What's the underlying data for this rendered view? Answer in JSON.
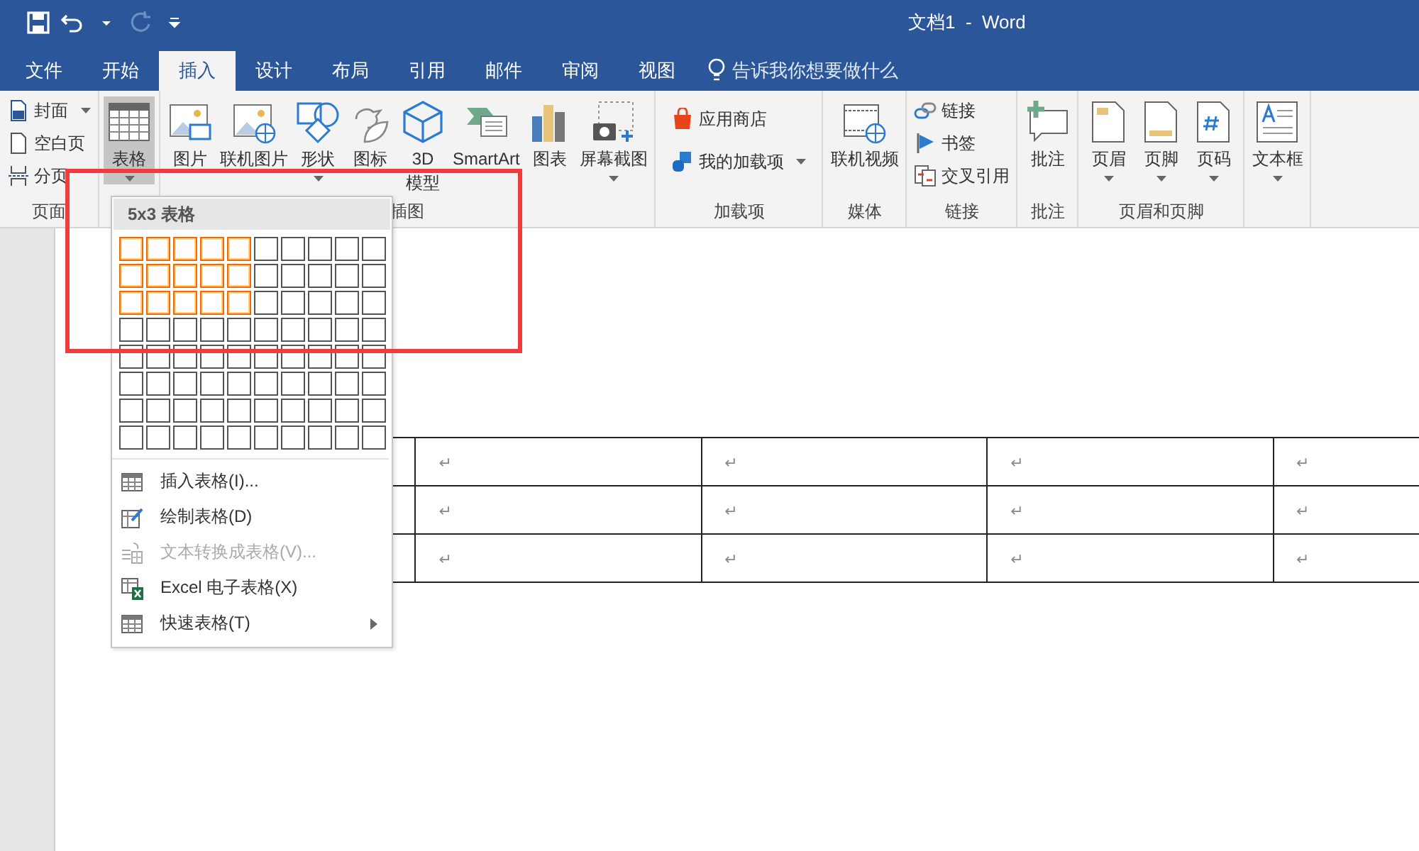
{
  "window": {
    "title": "文档1  -  Word"
  },
  "quick_access": [
    {
      "kind": "save",
      "disabled": false
    },
    {
      "kind": "undo",
      "disabled": false
    },
    {
      "kind": "caret",
      "disabled": false
    },
    {
      "kind": "redo",
      "disabled": true
    },
    {
      "kind": "customize",
      "disabled": false
    }
  ],
  "tabs": [
    {
      "label": "文件",
      "selected": false
    },
    {
      "label": "开始",
      "selected": false
    },
    {
      "label": "插入",
      "selected": true
    },
    {
      "label": "设计",
      "selected": false
    },
    {
      "label": "布局",
      "selected": false
    },
    {
      "label": "引用",
      "selected": false
    },
    {
      "label": "邮件",
      "selected": false
    },
    {
      "label": "审阅",
      "selected": false
    },
    {
      "label": "视图",
      "selected": false
    }
  ],
  "tell_me": {
    "placeholder": "告诉我你想要做什么"
  },
  "ribbon_groups": [
    {
      "label": "页面",
      "items": [
        {
          "kind": "small",
          "label": "封面",
          "dropdown": true,
          "pressed": false
        },
        {
          "kind": "small",
          "label": "空白页",
          "dropdown": false,
          "pressed": false
        },
        {
          "kind": "small",
          "label": "分页",
          "dropdown": false,
          "pressed": false
        }
      ]
    },
    {
      "items": [
        {
          "kind": "large",
          "label": "表格",
          "dropdown": true,
          "pressed": true
        }
      ]
    },
    {
      "label": "插图",
      "items": [
        {
          "kind": "large",
          "label": "图片",
          "dropdown": false,
          "pressed": false
        },
        {
          "kind": "large",
          "label": "联机图片",
          "dropdown": false,
          "pressed": false
        },
        {
          "kind": "large",
          "label": "形状",
          "dropdown": true,
          "pressed": false
        },
        {
          "kind": "large",
          "label": "图标",
          "dropdown": false,
          "pressed": false
        },
        {
          "kind": "large",
          "label": "3D 模型",
          "dropdown": false,
          "pressed": false
        },
        {
          "kind": "large",
          "label": "SmartArt",
          "dropdown": false,
          "pressed": false
        },
        {
          "kind": "large",
          "label": "图表",
          "dropdown": false,
          "pressed": false
        },
        {
          "kind": "large",
          "label": "屏幕截图",
          "dropdown": true,
          "pressed": false
        }
      ]
    },
    {
      "label": "加载项",
      "items": [
        {
          "kind": "medium",
          "label": "应用商店",
          "dropdown": false,
          "pressed": false
        },
        {
          "kind": "medium",
          "label": "我的加载项",
          "dropdown": true,
          "pressed": false
        }
      ]
    },
    {
      "label": "媒体",
      "items": [
        {
          "kind": "large",
          "label": "联机视频",
          "dropdown": false,
          "pressed": false
        }
      ]
    },
    {
      "label": "链接",
      "items": [
        {
          "kind": "small",
          "label": "链接",
          "dropdown": false,
          "pressed": false
        },
        {
          "kind": "small",
          "label": "书签",
          "dropdown": false,
          "pressed": false
        },
        {
          "kind": "small",
          "label": "交叉引用",
          "dropdown": false,
          "pressed": false
        }
      ]
    },
    {
      "label": "批注",
      "items": [
        {
          "kind": "large",
          "label": "批注",
          "dropdown": false,
          "pressed": false
        }
      ]
    },
    {
      "label": "页眉和页脚",
      "items": [
        {
          "kind": "large",
          "label": "页眉",
          "dropdown": true,
          "pressed": false
        },
        {
          "kind": "large",
          "label": "页脚",
          "dropdown": true,
          "pressed": false
        },
        {
          "kind": "large",
          "label": "页码",
          "dropdown": true,
          "pressed": false
        }
      ]
    },
    {
      "items": [
        {
          "kind": "large",
          "label": "文本框",
          "dropdown": true,
          "pressed": false
        }
      ]
    }
  ],
  "table_menu": {
    "header": "5x3 表格",
    "grid_rows": [
      {
        "cells": [
          {
            "selected": true
          },
          {
            "selected": true
          },
          {
            "selected": true
          },
          {
            "selected": true
          },
          {
            "selected": true
          },
          {
            "selected": false
          },
          {
            "selected": false
          },
          {
            "selected": false
          },
          {
            "selected": false
          },
          {
            "selected": false
          }
        ]
      },
      {
        "cells": [
          {
            "selected": true
          },
          {
            "selected": true
          },
          {
            "selected": true
          },
          {
            "selected": true
          },
          {
            "selected": true
          },
          {
            "selected": false
          },
          {
            "selected": false
          },
          {
            "selected": false
          },
          {
            "selected": false
          },
          {
            "selected": false
          }
        ]
      },
      {
        "cells": [
          {
            "selected": true
          },
          {
            "selected": true
          },
          {
            "selected": true
          },
          {
            "selected": true
          },
          {
            "selected": true
          },
          {
            "selected": false
          },
          {
            "selected": false
          },
          {
            "selected": false
          },
          {
            "selected": false
          },
          {
            "selected": false
          }
        ]
      },
      {
        "cells": [
          {
            "selected": false
          },
          {
            "selected": false
          },
          {
            "selected": false
          },
          {
            "selected": false
          },
          {
            "selected": false
          },
          {
            "selected": false
          },
          {
            "selected": false
          },
          {
            "selected": false
          },
          {
            "selected": false
          },
          {
            "selected": false
          }
        ]
      },
      {
        "cells": [
          {
            "selected": false
          },
          {
            "selected": false
          },
          {
            "selected": false
          },
          {
            "selected": false
          },
          {
            "selected": false
          },
          {
            "selected": false
          },
          {
            "selected": false
          },
          {
            "selected": false
          },
          {
            "selected": false
          },
          {
            "selected": false
          }
        ]
      },
      {
        "cells": [
          {
            "selected": false
          },
          {
            "selected": false
          },
          {
            "selected": false
          },
          {
            "selected": false
          },
          {
            "selected": false
          },
          {
            "selected": false
          },
          {
            "selected": false
          },
          {
            "selected": false
          },
          {
            "selected": false
          },
          {
            "selected": false
          }
        ]
      },
      {
        "cells": [
          {
            "selected": false
          },
          {
            "selected": false
          },
          {
            "selected": false
          },
          {
            "selected": false
          },
          {
            "selected": false
          },
          {
            "selected": false
          },
          {
            "selected": false
          },
          {
            "selected": false
          },
          {
            "selected": false
          },
          {
            "selected": false
          }
        ]
      },
      {
        "cells": [
          {
            "selected": false
          },
          {
            "selected": false
          },
          {
            "selected": false
          },
          {
            "selected": false
          },
          {
            "selected": false
          },
          {
            "selected": false
          },
          {
            "selected": false
          },
          {
            "selected": false
          },
          {
            "selected": false
          },
          {
            "selected": false
          }
        ]
      }
    ],
    "items": [
      {
        "label": "插入表格(I)...",
        "disabled": false,
        "submenu": false
      },
      {
        "label": "绘制表格(D)",
        "disabled": false,
        "submenu": false
      },
      {
        "label": "文本转换成表格(V)...",
        "disabled": true,
        "submenu": false
      },
      {
        "label": "Excel 电子表格(X)",
        "disabled": false,
        "submenu": false
      },
      {
        "label": "快速表格(T)",
        "disabled": false,
        "submenu": true
      }
    ]
  },
  "document_table": {
    "rows": [
      {
        "cells": [
          "",
          "↵",
          "↵",
          "↵",
          "↵"
        ]
      },
      {
        "cells": [
          "",
          "↵",
          "↵",
          "↵",
          "↵"
        ]
      },
      {
        "cells": [
          "",
          "↵",
          "↵",
          "↵",
          "↵"
        ]
      }
    ]
  }
}
